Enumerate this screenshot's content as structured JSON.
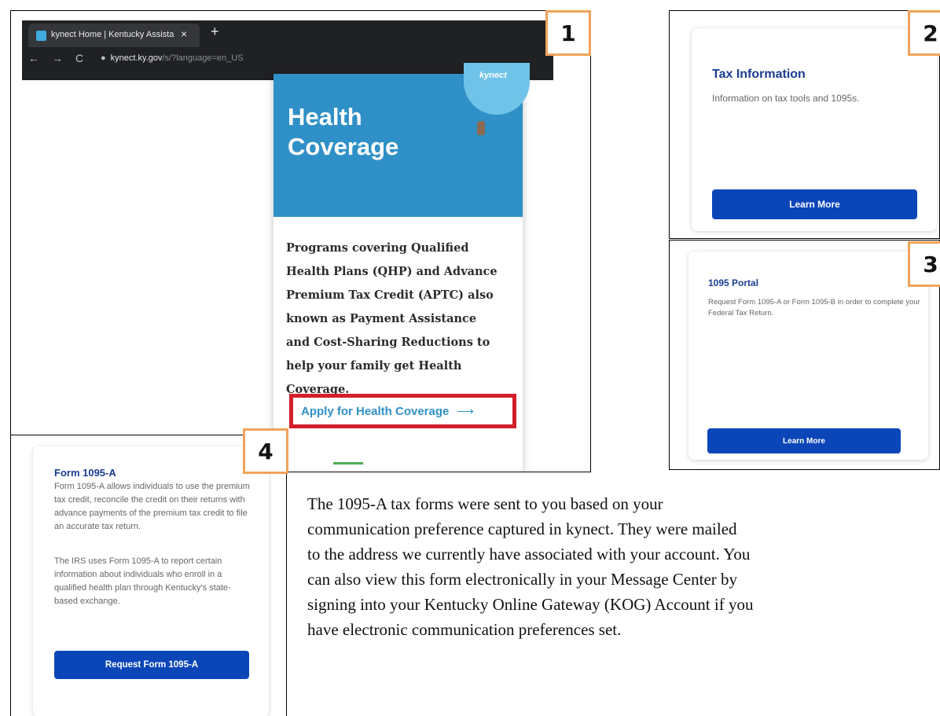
{
  "panel1": {
    "badge": "1",
    "browser": {
      "tab_title": "kynect Home | Kentucky Assista",
      "tab_close": "×",
      "new_tab": "+",
      "url_host": "kynect.ky.gov",
      "url_path": "/s/?language=en_US"
    },
    "balloon_brand": "kynect",
    "card_title": "Health Coverage",
    "card_body": "Programs covering Qualified Health Plans (QHP) and Advance Premium Tax Credit (APTC) also known as Payment Assistance and Cost-Sharing Reductions to help your family get Health Coverage.",
    "apply_link": "Apply for Health Coverage"
  },
  "panel2": {
    "badge": "2",
    "title": "Tax Information",
    "description": "Information on tax tools and 1095s.",
    "button": "Learn More"
  },
  "panel3": {
    "badge": "3",
    "title": "1095 Portal",
    "description": "Request Form 1095-A or Form 1095-B in order to complete your Federal Tax Return.",
    "button": "Learn More"
  },
  "panel4": {
    "badge": "4",
    "title": "Form 1095-A",
    "paragraph1": "Form 1095-A allows individuals to use the premium tax credit, reconcile the credit on their returns with advance payments of the premium tax credit to file an accurate tax return.",
    "paragraph2": "The IRS uses Form 1095-A to report certain information about individuals who enroll in a qualified health plan through Kentucky's state-based exchange.",
    "button": "Request Form 1095-A"
  },
  "description_lines": [
    "The 1095-A tax forms were sent to you based on your",
    "communication preference captured in kynect. They were mailed",
    "to the address we currently have associated with your account. You",
    "can also view this form electronically in your Message Center by",
    "signing into your Kentucky Online Gateway (KOG) Account if you",
    "have electronic communication preferences set."
  ]
}
